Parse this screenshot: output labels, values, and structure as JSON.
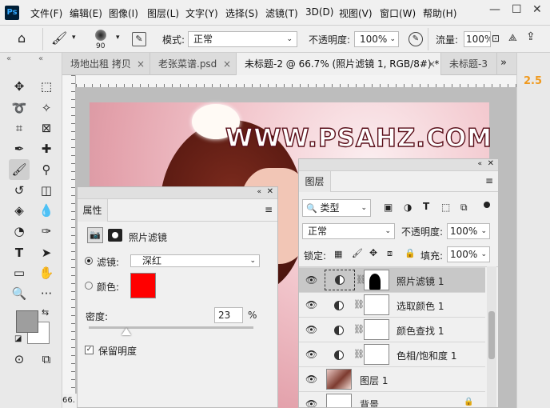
{
  "app": {
    "logo": "Ps"
  },
  "menu": [
    "文件(F)",
    "编辑(E)",
    "图像(I)",
    "图层(L)",
    "文字(Y)",
    "选择(S)",
    "滤镜(T)",
    "3D(D)",
    "视图(V)",
    "窗口(W)",
    "帮助(H)"
  ],
  "window_controls": {
    "minimize": "—",
    "maximize": "☐",
    "close": "✕"
  },
  "options": {
    "brush_size": "90",
    "mode_label": "模式:",
    "mode_value": "正常",
    "opacity_label": "不透明度:",
    "opacity_value": "100%",
    "flow_label": "流量:",
    "flow_value": "100%"
  },
  "tabs": [
    {
      "label": "场地出租 拷贝",
      "close": "×"
    },
    {
      "label": "老张菜谱.psd",
      "close": "×"
    },
    {
      "label": "未标题-2 @ 66.7% (照片滤镜 1, RGB/8#) *",
      "close": "×"
    },
    {
      "label": "未标题-3",
      "close": ""
    }
  ],
  "tabs_overflow": "»",
  "collapse_left": "«",
  "right_badge": "2.5",
  "zoom_status": "66.",
  "watermark": "WWW.PSAHZ.COM",
  "properties": {
    "tab_label": "属性",
    "header_title": "照片滤镜",
    "filter_label": "滤镜:",
    "filter_value": "深红",
    "color_label": "颜色:",
    "color_swatch": "#ff0000",
    "density_label": "密度:",
    "density_value": "23",
    "density_unit": "%",
    "density_level": 0.23,
    "preserve_label": "保留明度",
    "preserve_checked": true
  },
  "layers": {
    "tab_label": "图层",
    "kind_filter": "类型",
    "blend_mode": "正常",
    "opacity_label": "不透明度:",
    "opacity_value": "100%",
    "lock_label": "锁定:",
    "fill_label": "填充:",
    "fill_value": "100%",
    "items": [
      {
        "name": "照片滤镜 1",
        "type": "adjustment",
        "selected": true
      },
      {
        "name": "选取颜色 1",
        "type": "adjustment",
        "selected": false
      },
      {
        "name": "颜色查找 1",
        "type": "adjustment",
        "selected": false
      },
      {
        "name": "色相/饱和度 1",
        "type": "adjustment",
        "selected": false
      },
      {
        "name": "图层 1",
        "type": "image",
        "selected": false
      },
      {
        "name": "背景",
        "type": "image",
        "selected": false
      }
    ]
  },
  "colors": {
    "foreground": "#9e9e9e",
    "background": "#ffffff",
    "accent_badge": "#f09a1f"
  }
}
